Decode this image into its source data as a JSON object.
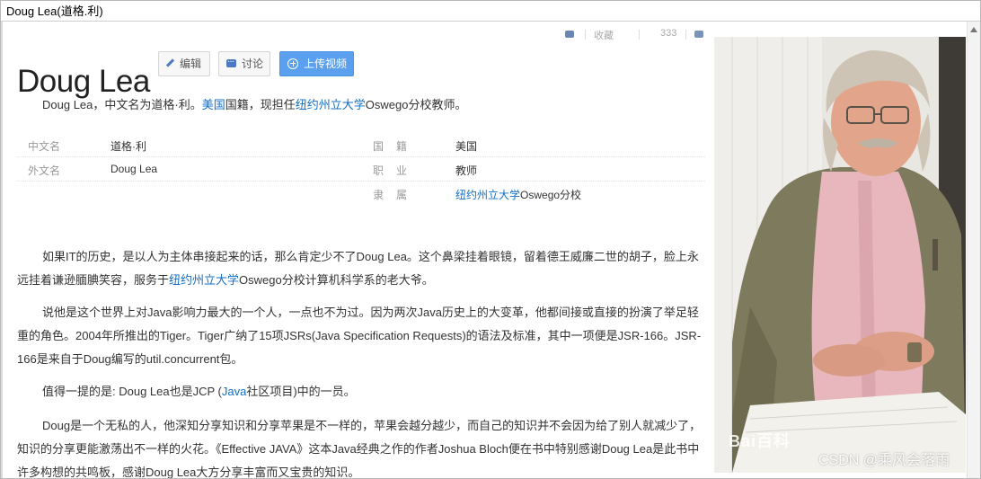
{
  "window": {
    "title": "Doug Lea(道格.利)"
  },
  "top_strip": {
    "item1": "收藏",
    "item2": "333"
  },
  "article": {
    "title": "Doug Lea",
    "buttons": {
      "edit": "编辑",
      "discuss": "讨论",
      "upload_video": "上传视频"
    },
    "summary": {
      "pre": "Doug Lea，中文名为道格·利。",
      "link1": "美国",
      "mid": "国籍，现担任",
      "link2": "纽约州立大学",
      "post": "Oswego分校教师。"
    },
    "info": {
      "row1": {
        "key1": "中文名",
        "val1": "道格·利",
        "key2": "国籍",
        "val2": "美国"
      },
      "row2": {
        "key1": "外文名",
        "val1": "Doug Lea",
        "key2": "职业",
        "val2": "教师"
      },
      "row3": {
        "key2": "隶属",
        "val2_link": "纽约州立大学",
        "val2_post": "Oswego分校"
      }
    },
    "paragraphs": {
      "p1": {
        "pre": "如果IT的历史，是以人为主体串接起来的话，那么肯定少不了Doug Lea。这个鼻梁挂着眼镜，留着德王威廉二世的胡子，脸上永远挂着谦逊腼腆笑容，服务于",
        "link": "纽约州立大学",
        "post": "Oswego分校计算机科学系的老大爷。"
      },
      "p2": "说他是这个世界上对Java影响力最大的一个人，一点也不为过。因为两次Java历史上的大变革，他都间接或直接的扮演了举足轻重的角色。2004年所推出的Tiger。Tiger广纳了15项JSRs(Java Specification Requests)的语法及标准，其中一项便是JSR-166。JSR-166是来自于Doug编写的util.concurrent包。",
      "p3": {
        "pre": "值得一提的是: Doug Lea也是JCP (",
        "link": "Java",
        "post": "社区项目)中的一员。"
      },
      "p4": "Doug是一个无私的人，他深知分享知识和分享苹果是不一样的，苹果会越分越少，而自己的知识并不会因为给了别人就减少了，知识的分享更能激荡出不一样的火花。《Effective JAVA》这本Java经典之作的作者Joshua Bloch便在书中特别感谢Doug Lea是此书中许多构想的共鸣板，感谢Doug Lea大方分享丰富而又宝贵的知识。"
    }
  },
  "photo": {
    "watermark_brand": "Bai百科",
    "watermark_csdn": "CSDN @乘风会落雨"
  },
  "colors": {
    "link": "#136ec2",
    "upload_button": "#5aa0ef",
    "key_text": "#999999"
  }
}
